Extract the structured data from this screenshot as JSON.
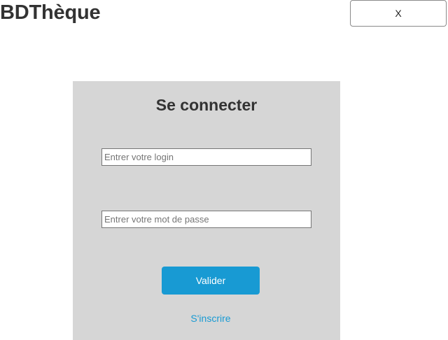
{
  "header": {
    "app_title": "BDThèque",
    "close_label": "X"
  },
  "login": {
    "title": "Se connecter",
    "login_placeholder": "Entrer votre login",
    "login_value": "",
    "password_placeholder": "Entrer votre mot de passe",
    "password_value": "",
    "submit_label": "Valider",
    "signup_label": "S'inscrire"
  },
  "colors": {
    "accent": "#189ad3",
    "panel_background": "#d6d6d6",
    "title_text": "#333333"
  }
}
